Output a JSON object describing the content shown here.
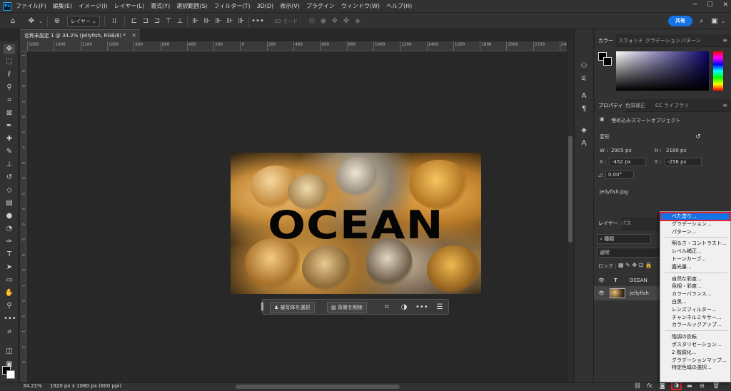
{
  "menu": {
    "items": [
      "ファイル(F)",
      "編集(E)",
      "イメージ(I)",
      "レイヤー(L)",
      "書式(Y)",
      "選択範囲(S)",
      "フィルター(T)",
      "3D(D)",
      "表示(V)",
      "プラグイン",
      "ウィンドウ(W)",
      "ヘルプ(H)"
    ]
  },
  "options": {
    "layer_select": "レイヤー",
    "mode_3d": "3D モード :",
    "share": "共有",
    "more": "•••"
  },
  "document": {
    "tab_title": "名称未設定 1 @ 34.2% (jellyfish, RGB/8) *",
    "tab_close": "×",
    "ruler_h_ticks": [
      "1600",
      "1400",
      "1200",
      "1000",
      "800",
      "600",
      "400",
      "200",
      "0",
      "200",
      "400",
      "600",
      "800",
      "1000",
      "1200",
      "1400",
      "1600",
      "1800",
      "2000",
      "2200",
      "2400"
    ],
    "ruler_v_ticks": [
      "1",
      "0",
      "0",
      "2",
      "0",
      "0",
      "4",
      "0",
      "0",
      "6",
      "0",
      "0",
      "8",
      "0",
      "0",
      "1",
      "0",
      "0",
      "1",
      "2",
      "0"
    ],
    "image_text": "OCEAN"
  },
  "taskbar": {
    "select_subject": "被写体を選択",
    "remove_bg": "背景を削除",
    "more": "•••"
  },
  "status": {
    "zoom": "34.21%",
    "doc_info": "1920 px x 1080 px (300 ppi)"
  },
  "color_panel": {
    "tabs": [
      "カラー",
      "スウォッチ",
      "グラデーション",
      "パターン"
    ]
  },
  "properties_panel": {
    "tabs": [
      "プロパティ",
      "色調補正",
      "CC ライブラリ"
    ],
    "object_type": "埋め込みスマートオブジェクト",
    "transform_heading": "変形",
    "w_label": "W :",
    "w_value": "2905 px",
    "h_label": "H :",
    "h_value": "2180 px",
    "x_label": "X :",
    "x_value": "-452 px",
    "y_label": "Y :",
    "y_value": "-256 px",
    "angle": "0.00°",
    "file_name": "jellyfish.jpg"
  },
  "layers_panel": {
    "tabs": [
      "レイヤー",
      "パス"
    ],
    "search_placeholder": "種類",
    "blend_mode": "通常",
    "lock_label": "ロック :",
    "layers": [
      {
        "type_icon": "T",
        "name": "OCEAN"
      },
      {
        "name": "jellyfish"
      }
    ],
    "fx": "fx."
  },
  "adjust_menu": {
    "groups": [
      [
        "べた塗り...",
        "グラデーション...",
        "パターン..."
      ],
      [
        "明るさ・コントラスト...",
        "レベル補正...",
        "トーンカーブ...",
        "露光量..."
      ],
      [
        "自然な彩度...",
        "色相・彩度...",
        "カラーバランス...",
        "白黒...",
        "レンズフィルター...",
        "チャンネルミキサー...",
        "カラールックアップ..."
      ],
      [
        "階調の反転",
        "ポスタリゼーション...",
        "2 階調化...",
        "グラデーションマップ...",
        "特定色域の選択..."
      ]
    ],
    "highlighted": "べた塗り..."
  },
  "colors": {
    "accent": "#1473e6",
    "highlight_outline": "#e0202a",
    "panel_bg": "#323232",
    "canvas_bg": "#282828"
  }
}
